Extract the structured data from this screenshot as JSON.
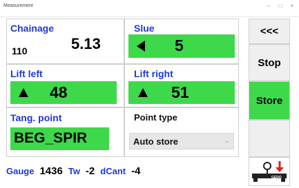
{
  "window": {
    "title": "Measurement",
    "minimize": "–",
    "maximize": "□",
    "close": "×"
  },
  "chainage": {
    "label": "Chainage",
    "sub_value": "110",
    "value": "5.13"
  },
  "slue": {
    "label": "Slue",
    "arrow": "left",
    "value": "5"
  },
  "lift_left": {
    "label": "Lift left",
    "arrow": "up",
    "value": "48"
  },
  "lift_right": {
    "label": "Lift right",
    "arrow": "up",
    "value": "51"
  },
  "tang_point": {
    "label": "Tang. point",
    "value": "BEG_SPIR"
  },
  "point_type": {
    "label": "Point type",
    "selected": "Auto store"
  },
  "bottom": {
    "gauge_label": "Gauge",
    "gauge_value": "1436",
    "tw_label": "Tw",
    "tw_value": "-2",
    "dcant_label": "dCant",
    "dcant_value": "-4"
  },
  "side_buttons": {
    "back": "<<<",
    "stop": "Stop",
    "store": "Store",
    "device_icon_text": "GEDO"
  },
  "colors": {
    "accent_blue": "#1f37d6",
    "value_green": "#3ed94a",
    "arrow_red": "#e02020"
  }
}
